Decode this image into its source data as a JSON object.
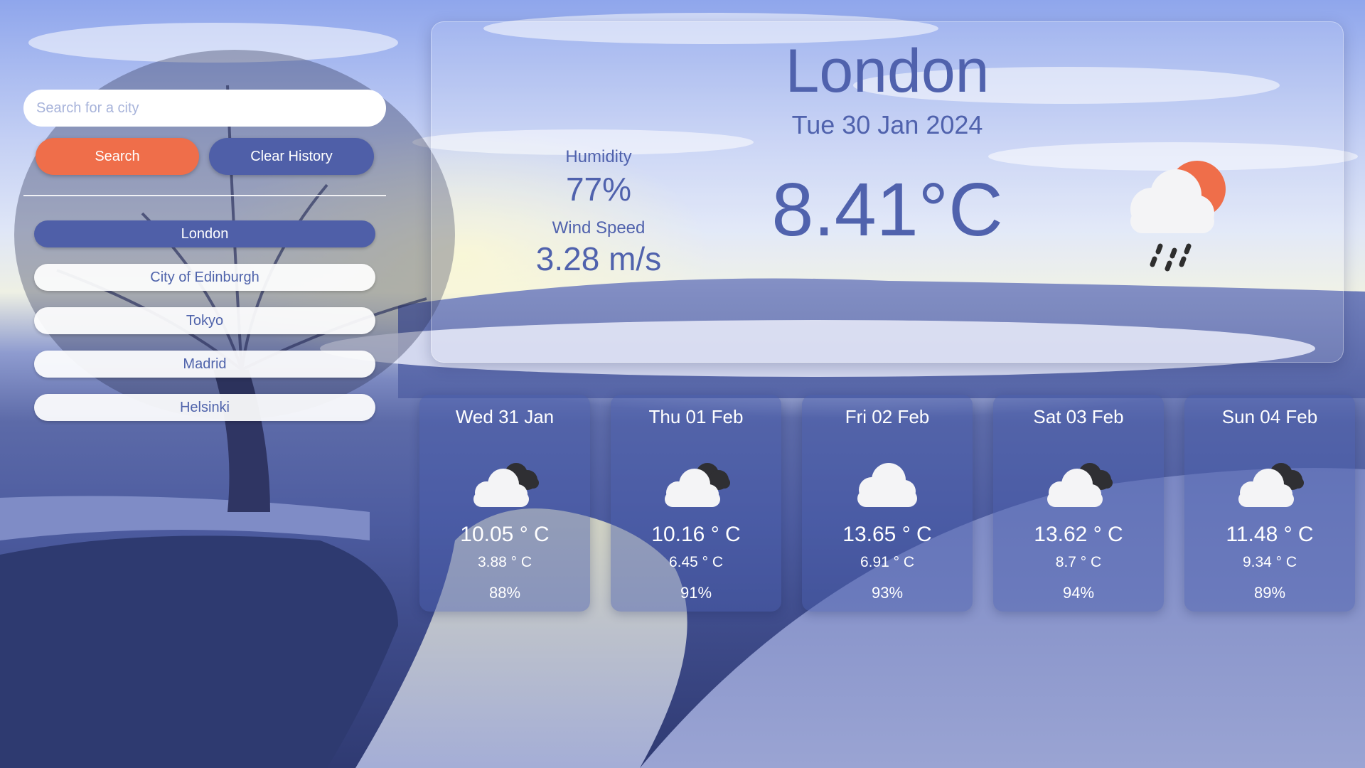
{
  "search": {
    "placeholder": "Search for a city",
    "value": ""
  },
  "buttons": {
    "search_label": "Search",
    "clear_label": "Clear History"
  },
  "history": {
    "items": [
      "London",
      "City of Edinburgh",
      "Tokyo",
      "Madrid",
      "Helsinki"
    ],
    "active": "London"
  },
  "current": {
    "city": "London",
    "date": "Tue 30 Jan 2024",
    "temperature": "8.41°C",
    "humidity_label": "Humidity",
    "humidity": "77%",
    "wind_label": "Wind Speed",
    "wind": "3.28 m/s",
    "icon": "sun-cloud-rain-icon"
  },
  "forecast": [
    {
      "day": "Wed 31 Jan",
      "high": "10.05 ° C",
      "low": "3.88 ° C",
      "humidity": "88%",
      "icon": "cloudy-icon"
    },
    {
      "day": "Thu 01 Feb",
      "high": "10.16 ° C",
      "low": "6.45 ° C",
      "humidity": "91%",
      "icon": "cloudy-icon"
    },
    {
      "day": "Fri 02 Feb",
      "high": "13.65 ° C",
      "low": "6.91 ° C",
      "humidity": "93%",
      "icon": "cloud-icon"
    },
    {
      "day": "Sat 03 Feb",
      "high": "13.62 ° C",
      "low": "8.7 ° C",
      "humidity": "94%",
      "icon": "cloudy-icon"
    },
    {
      "day": "Sun 04 Feb",
      "high": "11.48 ° C",
      "low": "9.34 ° C",
      "humidity": "89%",
      "icon": "cloudy-icon"
    }
  ],
  "colors": {
    "accent": "#ef6e4a",
    "primary": "#4f5fa8",
    "text": "#5062ad"
  }
}
